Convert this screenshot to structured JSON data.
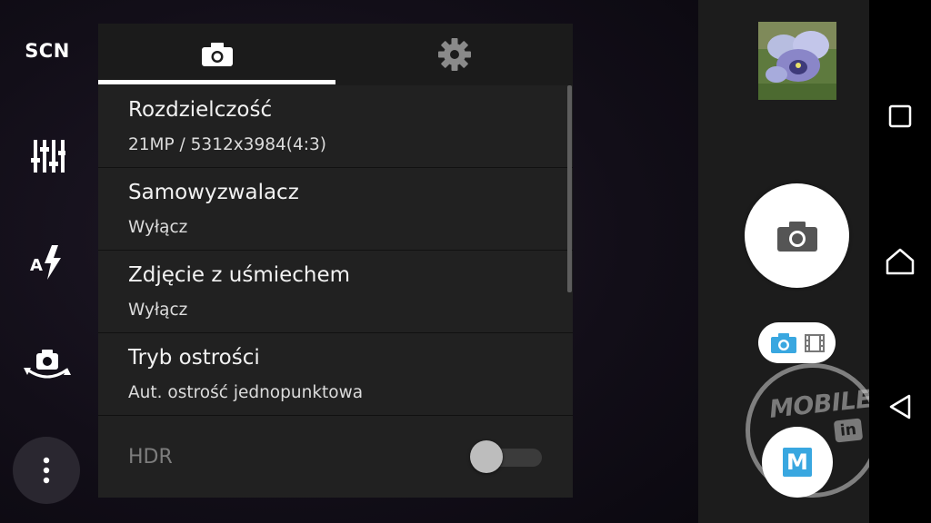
{
  "left_bar": {
    "scene_label": "SCN",
    "icons": [
      "sliders-icon",
      "auto-flash-icon",
      "switch-camera-icon",
      "more-vert-icon"
    ]
  },
  "panel": {
    "tabs": [
      {
        "icon": "camera-icon",
        "active": true
      },
      {
        "icon": "gear-icon",
        "active": false
      }
    ],
    "items": [
      {
        "title": "Rozdzielczość",
        "value": "21MP / 5312x3984(4:3)"
      },
      {
        "title": "Samowyzwalacz",
        "value": "Wyłącz"
      },
      {
        "title": "Zdjęcie z uśmiechem",
        "value": "Wyłącz"
      },
      {
        "title": "Tryb ostrości",
        "value": "Aut. ostrość jednopunktowa"
      }
    ],
    "hdr": {
      "label": "HDR",
      "enabled": false
    }
  },
  "controls": {
    "mode_badge": "M",
    "watermark": {
      "line1": "MOBILE",
      "badge": "in"
    },
    "accent_color": "#39a7e0"
  },
  "navbar": {
    "icons": [
      "recents-icon",
      "home-icon",
      "back-icon"
    ]
  }
}
